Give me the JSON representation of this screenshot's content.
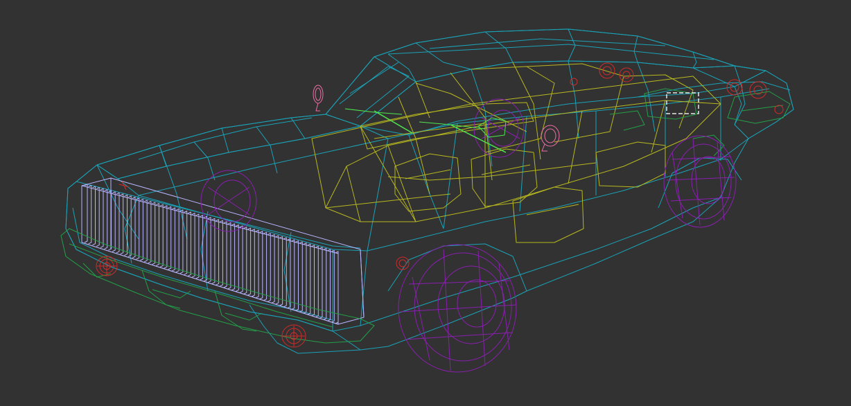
{
  "viewport": {
    "background": "#323232",
    "shading_mode": "wireframe",
    "object": "muscle-car-model"
  },
  "colors": {
    "body": "#1aa3b8",
    "interior": "#b8b81f",
    "grille": "#b8b6ff",
    "wheels": "#8a1fb0",
    "bumpers": "#23a048",
    "wipers": "#4fe84f",
    "mirrors": "#f06fa8",
    "lights": "#d22a2a",
    "plate": "#e8e8e8"
  },
  "icons": [
    "mirror-left",
    "mirror-right",
    "wiper-left",
    "wiper-right",
    "headlight",
    "taillight",
    "license-plate"
  ]
}
